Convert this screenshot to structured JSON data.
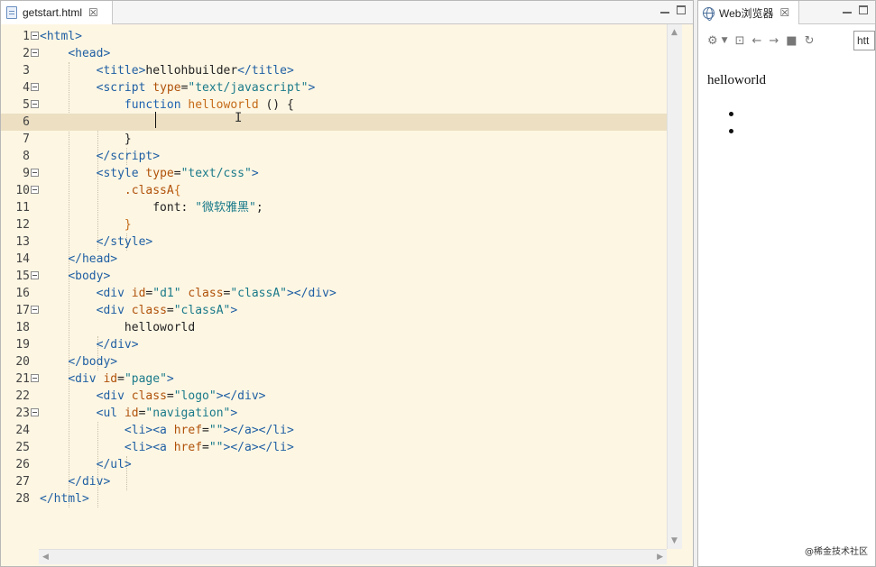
{
  "editor": {
    "tab_label": "getstart.html",
    "tab_close": "☒",
    "lines": [
      {
        "n": "1",
        "fold": true,
        "html": "<span class='t'>&lt;html&gt;</span>"
      },
      {
        "n": "2",
        "fold": true,
        "html": "    <span class='t'>&lt;head&gt;</span>"
      },
      {
        "n": "3",
        "fold": false,
        "html": "        <span class='t'>&lt;title&gt;</span><span class='p'>hellohbuilder</span><span class='t'>&lt;/title&gt;</span>"
      },
      {
        "n": "4",
        "fold": true,
        "html": "        <span class='t'>&lt;script</span> <span class='a'>type</span><span class='p'>=</span><span class='s'>\"text/javascript\"</span><span class='t'>&gt;</span>"
      },
      {
        "n": "5",
        "fold": true,
        "html": "            <span class='k'>function</span> <span class='f'>helloworld</span> <span class='p'>() {</span>"
      },
      {
        "n": "6",
        "fold": false,
        "html": ""
      },
      {
        "n": "7",
        "fold": false,
        "html": "            <span class='p'>}</span>"
      },
      {
        "n": "8",
        "fold": false,
        "html": "        <span class='t'>&lt;/script&gt;</span>"
      },
      {
        "n": "9",
        "fold": true,
        "html": "        <span class='t'>&lt;style</span> <span class='a'>type</span><span class='p'>=</span><span class='s'>\"text/css\"</span><span class='t'>&gt;</span>"
      },
      {
        "n": "10",
        "fold": true,
        "html": "            <span class='a'>.classA</span><span class='f'>{</span>"
      },
      {
        "n": "11",
        "fold": false,
        "html": "                <span class='p'>font: </span><span class='s'>\"微软雅黑\"</span><span class='p'>;</span>"
      },
      {
        "n": "12",
        "fold": false,
        "html": "            <span class='f'>}</span>"
      },
      {
        "n": "13",
        "fold": false,
        "html": "        <span class='t'>&lt;/style&gt;</span>"
      },
      {
        "n": "14",
        "fold": false,
        "html": "    <span class='t'>&lt;/head&gt;</span>"
      },
      {
        "n": "15",
        "fold": true,
        "html": "    <span class='t'>&lt;body&gt;</span>"
      },
      {
        "n": "16",
        "fold": false,
        "html": "        <span class='t'>&lt;div</span> <span class='a'>id</span><span class='p'>=</span><span class='s'>\"d1\"</span> <span class='a'>class</span><span class='p'>=</span><span class='s'>\"classA\"</span><span class='t'>&gt;&lt;/div&gt;</span>"
      },
      {
        "n": "17",
        "fold": true,
        "html": "        <span class='t'>&lt;div</span> <span class='a'>class</span><span class='p'>=</span><span class='s'>\"classA\"</span><span class='t'>&gt;</span>"
      },
      {
        "n": "18",
        "fold": false,
        "html": "            <span class='p'>helloworld</span>"
      },
      {
        "n": "19",
        "fold": false,
        "html": "        <span class='t'>&lt;/div&gt;</span>"
      },
      {
        "n": "20",
        "fold": false,
        "html": "    <span class='t'>&lt;/body&gt;</span>"
      },
      {
        "n": "21",
        "fold": true,
        "html": "    <span class='t'>&lt;div</span> <span class='a'>id</span><span class='p'>=</span><span class='s'>\"page\"</span><span class='t'>&gt;</span>"
      },
      {
        "n": "22",
        "fold": false,
        "html": "        <span class='t'>&lt;div</span> <span class='a'>class</span><span class='p'>=</span><span class='s'>\"logo\"</span><span class='t'>&gt;&lt;/div&gt;</span>"
      },
      {
        "n": "23",
        "fold": true,
        "html": "        <span class='t'>&lt;ul</span> <span class='a'>id</span><span class='p'>=</span><span class='s'>\"navigation\"</span><span class='t'>&gt;</span>"
      },
      {
        "n": "24",
        "fold": false,
        "html": "            <span class='t'>&lt;li&gt;&lt;a</span> <span class='a'>href</span><span class='p'>=</span><span class='s'>\"\"</span><span class='t'>&gt;&lt;/a&gt;&lt;/li&gt;</span>"
      },
      {
        "n": "25",
        "fold": false,
        "html": "            <span class='t'>&lt;li&gt;&lt;a</span> <span class='a'>href</span><span class='p'>=</span><span class='s'>\"\"</span><span class='t'>&gt;&lt;/a&gt;&lt;/li&gt;</span>"
      },
      {
        "n": "26",
        "fold": false,
        "html": "        <span class='t'>&lt;/ul&gt;</span>"
      },
      {
        "n": "27",
        "fold": false,
        "html": "    <span class='t'>&lt;/div&gt;</span>"
      },
      {
        "n": "28",
        "fold": false,
        "html": "<span class='t'>&lt;/html&gt;</span>"
      }
    ],
    "current_line": "6"
  },
  "browser": {
    "tab_label": "Web浏览器",
    "tab_close": "☒",
    "url_value": "htt",
    "page_text": "helloworld",
    "bullets": [
      "",
      ""
    ],
    "watermark": "@稀金技术社区"
  }
}
